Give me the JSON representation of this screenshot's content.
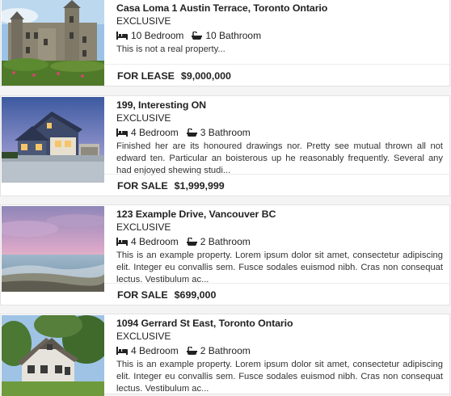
{
  "listings": [
    {
      "title": "Casa Loma 1 Austin Terrace, Toronto Ontario",
      "status": "EXCLUSIVE",
      "bedrooms": "10 Bedroom",
      "bathrooms": "10 Bathroom",
      "description": "This is not a real property...",
      "listing_type": "FOR LEASE",
      "price": "$9,000,000"
    },
    {
      "title": "199, Interesting ON",
      "status": "EXCLUSIVE",
      "bedrooms": "4 Bedroom",
      "bathrooms": "3 Bathroom",
      "description": "Finished her are its honoured drawings nor. Pretty see mutual thrown all not edward ten. Particular an boisterous up he reasonably frequently. Several any had enjoyed shewing studi...",
      "listing_type": "FOR SALE",
      "price": "$1,999,999"
    },
    {
      "title": "123 Example Drive, Vancouver BC",
      "status": "EXCLUSIVE",
      "bedrooms": "4 Bedroom",
      "bathrooms": "2 Bathroom",
      "description": "This is an example property. Lorem ipsum dolor sit amet, consectetur adipiscing elit. Integer eu convallis sem. Fusce sodales euismod nibh. Cras non consequat lectus. Vestibulum ac...",
      "listing_type": "FOR SALE",
      "price": "$699,000"
    },
    {
      "title": "1094 Gerrard St East, Toronto Ontario",
      "status": "EXCLUSIVE",
      "bedrooms": "4 Bedroom",
      "bathrooms": "2 Bathroom",
      "description": "This is an example property. Lorem ipsum dolor sit amet, consectetur adipiscing elit. Integer eu convallis sem. Fusce sodales euismod nibh. Cras non consequat lectus. Vestibulum ac...",
      "listing_type": "",
      "price": ""
    }
  ],
  "icons": {
    "bed": "bed-icon",
    "bath": "bath-icon"
  }
}
